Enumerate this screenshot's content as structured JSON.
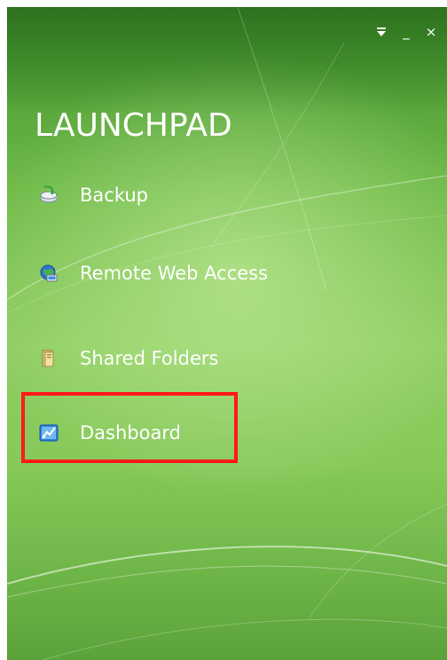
{
  "app": {
    "title": "LAUNCHPAD"
  },
  "window_controls": {
    "options_icon": "dropdown-arrow-icon",
    "minimize_icon": "minimize-icon",
    "close_icon": "close-icon",
    "minimize_glyph": "_",
    "close_glyph": "×"
  },
  "menu": {
    "items": [
      {
        "label": "Backup",
        "icon": "backup-icon"
      },
      {
        "label": "Remote Web Access",
        "icon": "remote-web-access-icon"
      },
      {
        "label": "Shared Folders",
        "icon": "shared-folders-icon"
      },
      {
        "label": "Dashboard",
        "icon": "dashboard-icon"
      }
    ]
  },
  "highlight": {
    "target": "Dashboard",
    "color": "#ff1a1a"
  },
  "colors": {
    "background_dark": "#3f8f2b",
    "background_light": "#8fce62",
    "text": "#ffffff"
  }
}
